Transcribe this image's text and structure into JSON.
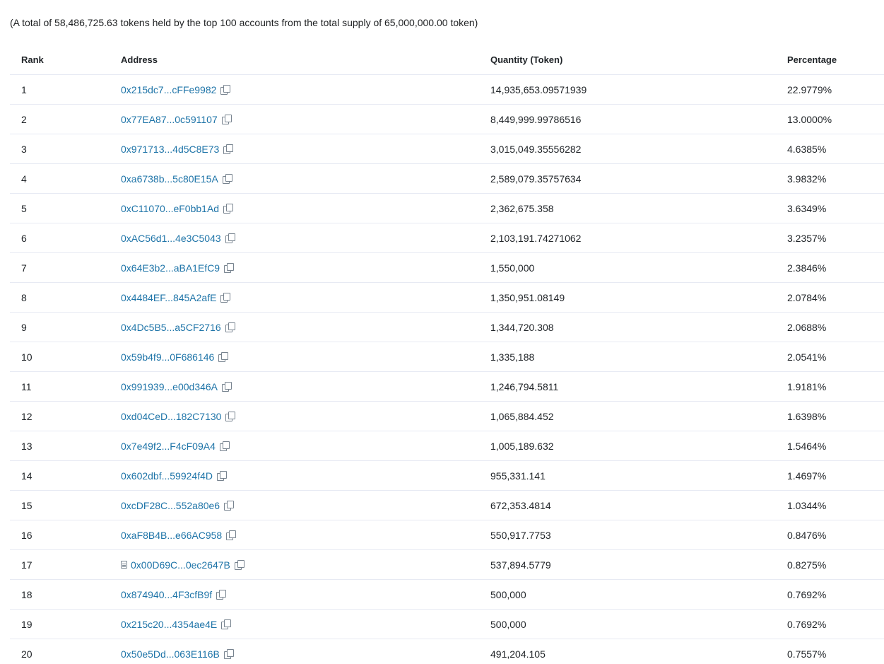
{
  "summary": "(A total of 58,486,725.63 tokens held by the top 100 accounts from the total supply of 65,000,000.00 token)",
  "columns": {
    "rank": "Rank",
    "address": "Address",
    "quantity": "Quantity (Token)",
    "percentage": "Percentage"
  },
  "icons": {
    "copy": "copy-icon",
    "contract": "contract-icon"
  },
  "colors": {
    "link": "#1e74a8",
    "border": "#e7eaf3",
    "text": "#212529"
  },
  "rows": [
    {
      "rank": "1",
      "address": "0x215dc7...cFFe9982",
      "quantity": "14,935,653.09571939",
      "percentage": "22.9779%",
      "contract": false
    },
    {
      "rank": "2",
      "address": "0x77EA87...0c591107",
      "quantity": "8,449,999.99786516",
      "percentage": "13.0000%",
      "contract": false
    },
    {
      "rank": "3",
      "address": "0x971713...4d5C8E73",
      "quantity": "3,015,049.35556282",
      "percentage": "4.6385%",
      "contract": false
    },
    {
      "rank": "4",
      "address": "0xa6738b...5c80E15A",
      "quantity": "2,589,079.35757634",
      "percentage": "3.9832%",
      "contract": false
    },
    {
      "rank": "5",
      "address": "0xC11070...eF0bb1Ad",
      "quantity": "2,362,675.358",
      "percentage": "3.6349%",
      "contract": false
    },
    {
      "rank": "6",
      "address": "0xAC56d1...4e3C5043",
      "quantity": "2,103,191.74271062",
      "percentage": "3.2357%",
      "contract": false
    },
    {
      "rank": "7",
      "address": "0x64E3b2...aBA1EfC9",
      "quantity": "1,550,000",
      "percentage": "2.3846%",
      "contract": false
    },
    {
      "rank": "8",
      "address": "0x4484EF...845A2afE",
      "quantity": "1,350,951.08149",
      "percentage": "2.0784%",
      "contract": false
    },
    {
      "rank": "9",
      "address": "0x4Dc5B5...a5CF2716",
      "quantity": "1,344,720.308",
      "percentage": "2.0688%",
      "contract": false
    },
    {
      "rank": "10",
      "address": "0x59b4f9...0F686146",
      "quantity": "1,335,188",
      "percentage": "2.0541%",
      "contract": false
    },
    {
      "rank": "11",
      "address": "0x991939...e00d346A",
      "quantity": "1,246,794.5811",
      "percentage": "1.9181%",
      "contract": false
    },
    {
      "rank": "12",
      "address": "0xd04CeD...182C7130",
      "quantity": "1,065,884.452",
      "percentage": "1.6398%",
      "contract": false
    },
    {
      "rank": "13",
      "address": "0x7e49f2...F4cF09A4",
      "quantity": "1,005,189.632",
      "percentage": "1.5464%",
      "contract": false
    },
    {
      "rank": "14",
      "address": "0x602dbf...59924f4D",
      "quantity": "955,331.141",
      "percentage": "1.4697%",
      "contract": false
    },
    {
      "rank": "15",
      "address": "0xcDF28C...552a80e6",
      "quantity": "672,353.4814",
      "percentage": "1.0344%",
      "contract": false
    },
    {
      "rank": "16",
      "address": "0xaF8B4B...e66AC958",
      "quantity": "550,917.7753",
      "percentage": "0.8476%",
      "contract": false
    },
    {
      "rank": "17",
      "address": "0x00D69C...0ec2647B",
      "quantity": "537,894.5779",
      "percentage": "0.8275%",
      "contract": true
    },
    {
      "rank": "18",
      "address": "0x874940...4F3cfB9f",
      "quantity": "500,000",
      "percentage": "0.7692%",
      "contract": false
    },
    {
      "rank": "19",
      "address": "0x215c20...4354ae4E",
      "quantity": "500,000",
      "percentage": "0.7692%",
      "contract": false
    },
    {
      "rank": "20",
      "address": "0x50e5Dd...063E116B",
      "quantity": "491,204.105",
      "percentage": "0.7557%",
      "contract": false
    }
  ]
}
